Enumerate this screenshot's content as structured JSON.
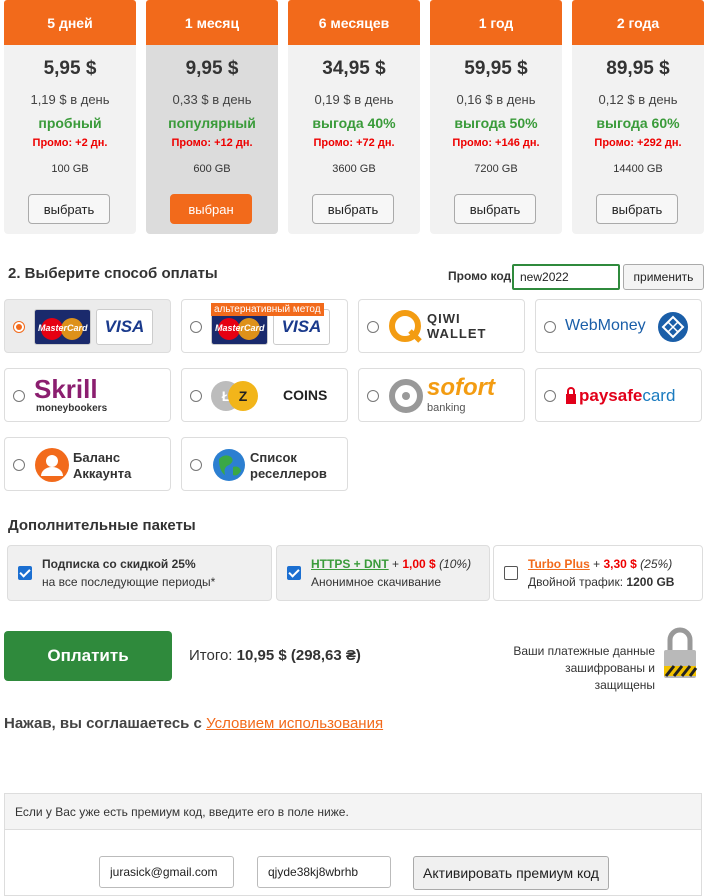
{
  "plans": [
    {
      "period": "5 дней",
      "price": "5,95 $",
      "per_day": "1,19 $ в день",
      "tag": "пробный",
      "promo": "Промо: +2 дн.",
      "gb": "100 GB",
      "button": "выбрать"
    },
    {
      "period": "1 месяц",
      "price": "9,95 $",
      "per_day": "0,33 $ в день",
      "tag": "популярный",
      "promo": "Промо: +12 дн.",
      "gb": "600 GB",
      "button": "выбран"
    },
    {
      "period": "6 месяцев",
      "price": "34,95 $",
      "per_day": "0,19 $ в день",
      "tag": "выгода 40%",
      "promo": "Промо: +72 дн.",
      "gb": "3600 GB",
      "button": "выбрать"
    },
    {
      "period": "1 год",
      "price": "59,95 $",
      "per_day": "0,16 $ в день",
      "tag": "выгода 50%",
      "promo": "Промо: +146 дн.",
      "gb": "7200 GB",
      "button": "выбрать"
    },
    {
      "period": "2 года",
      "price": "89,95 $",
      "per_day": "0,12 $ в день",
      "tag": "выгода 60%",
      "promo": "Промо: +292 дн.",
      "gb": "14400 GB",
      "button": "выбрать"
    }
  ],
  "payment": {
    "title": "2. Выберите способ оплаты",
    "promo_label": "Промо код",
    "promo_value": "new2022",
    "apply": "применить",
    "alt_badge": "альтернативный метод",
    "card_mc": "MasterCard",
    "card_visa": "VISA",
    "qiwi": "QIWI WALLET",
    "qiwi_l1": "QIWI",
    "qiwi_l2": "WALLET",
    "webmoney": "WebMoney",
    "skrill": "Skrill",
    "skrill_sub": "moneybookers",
    "coins": "COINS",
    "sofort": "sofort",
    "sofort_sub": "banking",
    "paysafe_a": "paysafe",
    "paysafe_b": "card",
    "balance_l1": "Баланс",
    "balance_l2": "Аккаунта",
    "resellers_l1": "Список",
    "resellers_l2": "реселлеров"
  },
  "addons": {
    "title": "Дополнительные пакеты",
    "a1_l1": "Подписка со скидкой 25%",
    "a1_l2": "на все последующие периоды*",
    "a2_name": "HTTPS + DNT",
    "a2_plus": " + ",
    "a2_price": "1,00 $",
    "a2_pct": " (10%)",
    "a2_l2": "Анонимное скачивание",
    "a3_name": "Turbo Plus",
    "a3_plus": " + ",
    "a3_price": "3,30 $",
    "a3_pct": " (25%)",
    "a3_l2a": "Двойной трафик: ",
    "a3_l2b": "1200 GB"
  },
  "checkout": {
    "pay": "Оплатить",
    "total_label": "Итого: ",
    "total_value": "10,95 $ (298,63 ₴)",
    "secure_l1": "Ваши платежные данные",
    "secure_l2": "зашифрованы и",
    "secure_l3": "защищены",
    "agree_text": "Нажав, вы соглашаетесь с ",
    "agree_link": "Условием использования"
  },
  "premium": {
    "note": "Если у Вас уже есть премиум код, введите его в поле ниже.",
    "email": "jurasick@gmail.com",
    "code": "qjyde38kj8wbrhb",
    "activate": "Активировать премиум код"
  },
  "colors": {
    "accent": "#f26a1b",
    "green": "#2f8a3c",
    "tag_green": "#3a9b3a",
    "promo_red": "#e00000"
  }
}
